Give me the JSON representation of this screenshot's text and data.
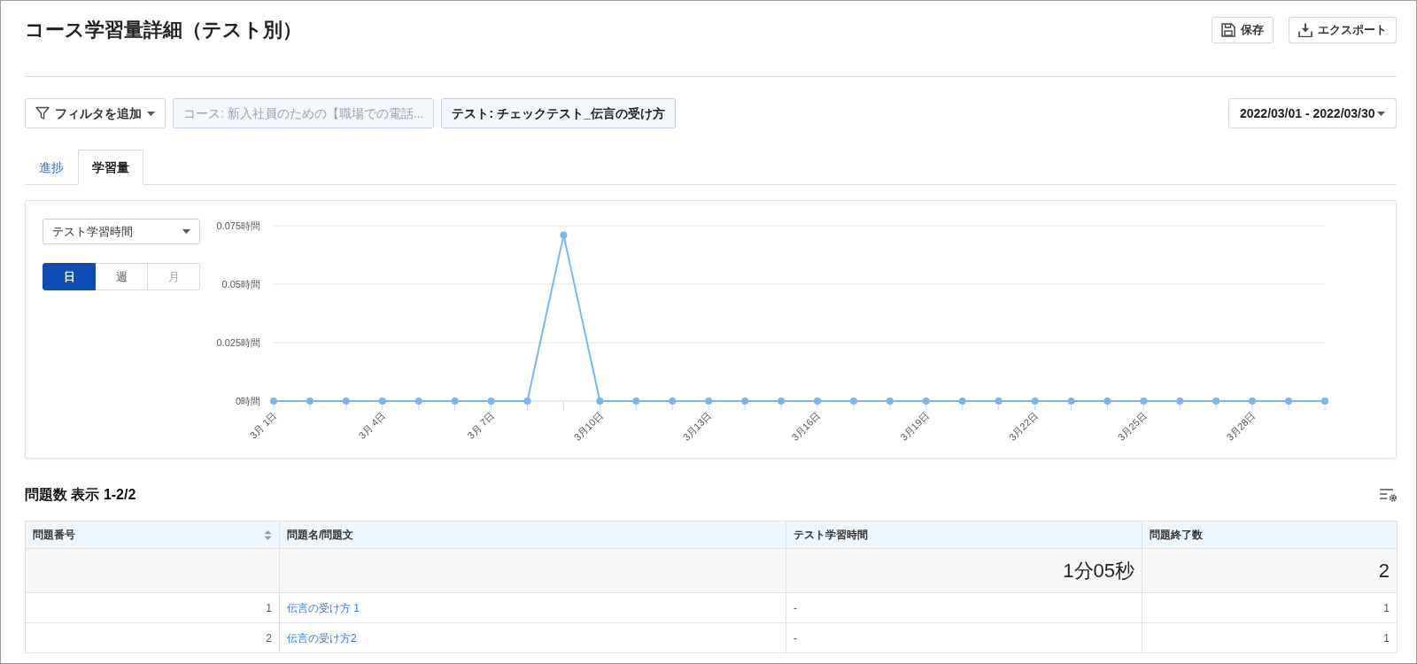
{
  "page": {
    "title": "コース学習量詳細（テスト別）"
  },
  "header_buttons": [
    {
      "kind": "save",
      "label": "保存"
    },
    {
      "kind": "export",
      "label": "エクスポート"
    }
  ],
  "filters": {
    "add_filter": "フィルタを追加",
    "chips": [
      {
        "label": "コース: 新入社員のための【職場での電話...",
        "disabled": true
      },
      {
        "label": "テスト: チェックテスト_伝言の受け方",
        "disabled": false
      }
    ],
    "date_range": "2022/03/01 - 2022/03/30"
  },
  "tabs": [
    {
      "label": "進捗",
      "selected": false
    },
    {
      "label": "学習量",
      "selected": true
    }
  ],
  "chart_panel": {
    "metric": "テスト学習時間",
    "periods": [
      {
        "label": "日",
        "selected": true,
        "disabled": false
      },
      {
        "label": "週",
        "selected": false,
        "disabled": false
      },
      {
        "label": "月",
        "selected": false,
        "disabled": true
      }
    ],
    "chart_data": {
      "type": "line",
      "categories": [
        "3月 1日",
        null,
        null,
        "3月 4日",
        null,
        null,
        "3月 7日",
        null,
        null,
        "3月10日",
        null,
        null,
        "3月13日",
        null,
        null,
        "3月16日",
        null,
        null,
        "3月19日",
        null,
        null,
        "3月22日",
        null,
        null,
        "3月25日",
        null,
        null,
        "3月28日",
        null,
        null
      ],
      "series": [
        {
          "color": "#7cb5ec",
          "marker": true,
          "values": [
            0,
            0,
            0,
            0,
            0,
            0,
            0,
            0,
            0.071,
            0,
            0,
            0,
            0,
            0,
            0,
            0,
            0,
            0,
            0,
            0,
            0,
            0,
            0,
            0,
            0,
            0,
            0,
            0,
            0,
            0
          ]
        }
      ],
      "ylim": [
        0,
        0.075
      ],
      "yticks": [
        {
          "value": 0,
          "label": "0時間"
        },
        {
          "value": 0.025,
          "label": "0.025時間"
        },
        {
          "value": 0.05,
          "label": "0.05時間"
        },
        {
          "value": 0.075,
          "label": "0.075時間"
        }
      ]
    }
  },
  "table": {
    "title": "問題数 表示 1-2/2",
    "columns": [
      {
        "label": "問題番号",
        "sortable": true
      },
      {
        "label": "問題名/問題文",
        "sortable": false
      },
      {
        "label": "テスト学習時間",
        "sortable": false
      },
      {
        "label": "問題終了数",
        "sortable": false
      }
    ],
    "summary": {
      "study_time": "1分05秒",
      "completed": "2"
    },
    "rows": [
      {
        "number": "1",
        "name": "伝言の受け方 1",
        "study_time": "-",
        "completed": "1"
      },
      {
        "number": "2",
        "name": "伝言の受け方2",
        "study_time": "-",
        "completed": "1"
      }
    ]
  }
}
